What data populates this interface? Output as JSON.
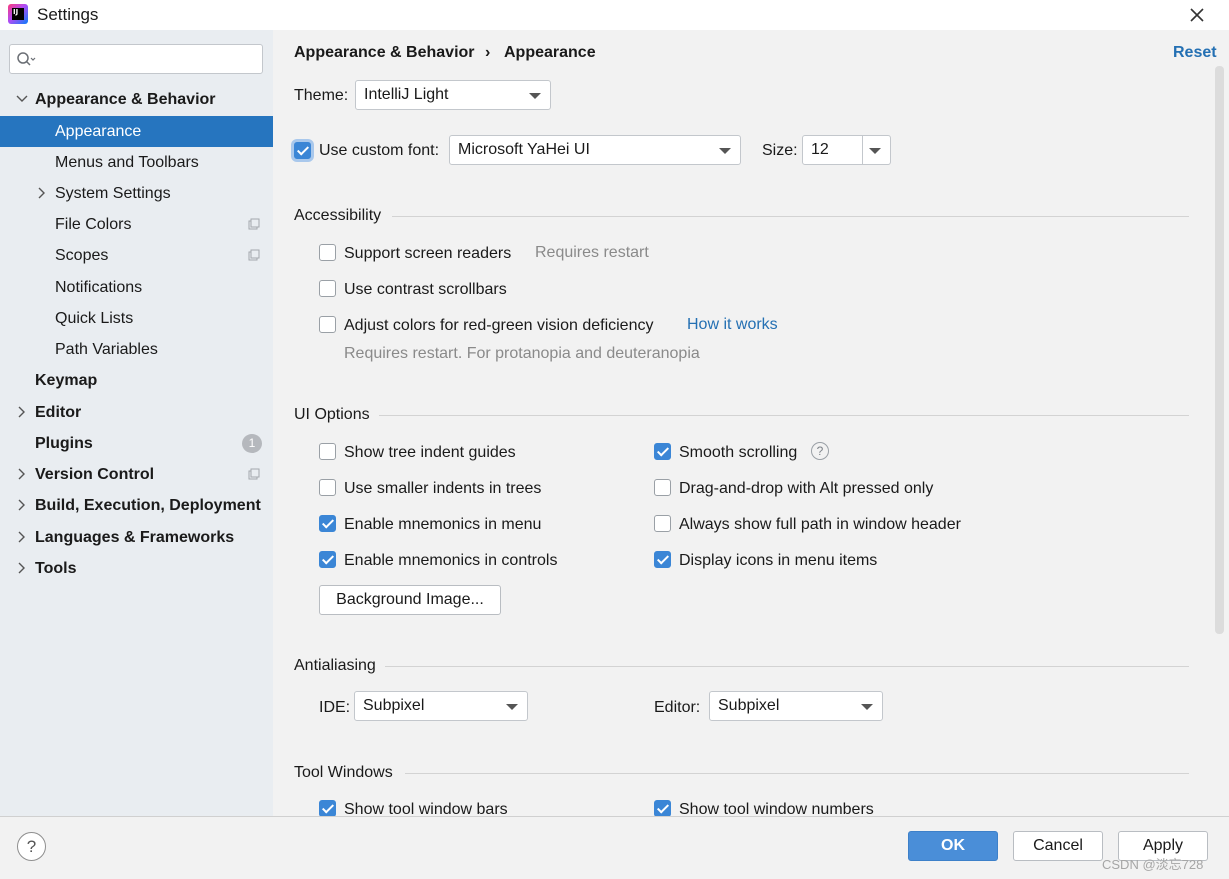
{
  "window": {
    "title": "Settings"
  },
  "search": {
    "placeholder": ""
  },
  "sidebar": {
    "items": [
      {
        "label": "Appearance & Behavior"
      },
      {
        "label": "Appearance"
      },
      {
        "label": "Menus and Toolbars"
      },
      {
        "label": "System Settings"
      },
      {
        "label": "File Colors"
      },
      {
        "label": "Scopes"
      },
      {
        "label": "Notifications"
      },
      {
        "label": "Quick Lists"
      },
      {
        "label": "Path Variables"
      },
      {
        "label": "Keymap"
      },
      {
        "label": "Editor"
      },
      {
        "label": "Plugins",
        "badge": "1"
      },
      {
        "label": "Version Control"
      },
      {
        "label": "Build, Execution, Deployment"
      },
      {
        "label": "Languages & Frameworks"
      },
      {
        "label": "Tools"
      }
    ]
  },
  "header": {
    "breadcrumb": [
      "Appearance & Behavior",
      "Appearance"
    ],
    "breadcrumb_sep": "›",
    "reset": "Reset"
  },
  "theme": {
    "label": "Theme:",
    "value": "IntelliJ Light"
  },
  "font": {
    "checkbox_label": "Use custom font:",
    "checked": true,
    "value": "Microsoft YaHei UI",
    "size_label": "Size:",
    "size_value": "12"
  },
  "accessibility": {
    "title": "Accessibility",
    "screen_readers": "Support screen readers",
    "screen_readers_note": "Requires restart",
    "contrast_scrollbars": "Use contrast scrollbars",
    "red_green": "Adjust colors for red-green vision deficiency",
    "how_it_works": "How it works",
    "red_green_note": "Requires restart. For protanopia and deuteranopia"
  },
  "ui_options": {
    "title": "UI Options",
    "left": [
      {
        "label": "Show tree indent guides",
        "checked": false
      },
      {
        "label": "Use smaller indents in trees",
        "checked": false
      },
      {
        "label": "Enable mnemonics in menu",
        "checked": true
      },
      {
        "label": "Enable mnemonics in controls",
        "checked": true
      }
    ],
    "right": [
      {
        "label": "Smooth scrolling",
        "checked": true
      },
      {
        "label": "Drag-and-drop with Alt pressed only",
        "checked": false
      },
      {
        "label": "Always show full path in window header",
        "checked": false
      },
      {
        "label": "Display icons in menu items",
        "checked": true
      }
    ],
    "background_image": "Background Image..."
  },
  "antialiasing": {
    "title": "Antialiasing",
    "ide_label": "IDE:",
    "ide_value": "Subpixel",
    "editor_label": "Editor:",
    "editor_value": "Subpixel"
  },
  "tool_windows": {
    "title": "Tool Windows",
    "show_bars": "Show tool window bars",
    "show_numbers": "Show tool window numbers"
  },
  "footer": {
    "help": "?",
    "ok": "OK",
    "cancel": "Cancel",
    "apply": "Apply",
    "watermark": "CSDN @淡忘728"
  },
  "colors": {
    "accent": "#2675bf",
    "link": "#2470b3",
    "checkbox": "#3b86d6",
    "ok_button": "#4a8ed8"
  }
}
